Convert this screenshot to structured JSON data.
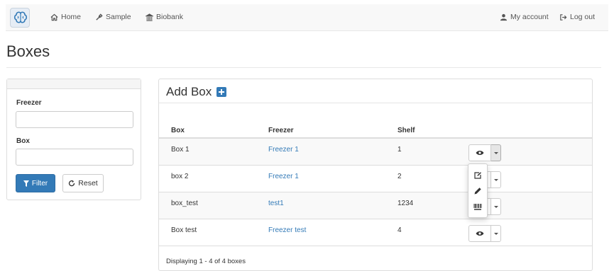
{
  "nav": {
    "brand_icon": "brain-logo-icon",
    "items": [
      {
        "label": "Home",
        "icon": "home-icon"
      },
      {
        "label": "Sample",
        "icon": "eyedropper-icon"
      },
      {
        "label": "Biobank",
        "icon": "building-icon"
      }
    ],
    "right_items": [
      {
        "label": "My account",
        "icon": "user-icon"
      },
      {
        "label": "Log out",
        "icon": "logout-icon"
      }
    ]
  },
  "page": {
    "title": "Boxes"
  },
  "filter": {
    "freezer_label": "Freezer",
    "freezer_value": "",
    "box_label": "Box",
    "box_value": "",
    "filter_button": "Filter",
    "reset_button": "Reset"
  },
  "boxes_panel": {
    "title": "Add Box",
    "columns": [
      "Box",
      "Freezer",
      "Shelf"
    ],
    "rows": [
      {
        "box": "Box 1",
        "freezer": "Freezer 1",
        "shelf": "1"
      },
      {
        "box": "box 2",
        "freezer": "Freezer 1",
        "shelf": "2"
      },
      {
        "box": "box_test",
        "freezer": "test1",
        "shelf": "1234"
      },
      {
        "box": "Box test",
        "freezer": "Freezer test",
        "shelf": "4"
      }
    ],
    "footer": "Displaying 1 - 4 of 4 boxes"
  },
  "dropdown_menu": {
    "open_for_row": 0,
    "items": [
      "edit-icon",
      "pencil-icon",
      "barcode-icon"
    ]
  },
  "colors": {
    "primary": "#337ab7",
    "link": "#337ab7",
    "navbar_bg": "#f8f8f8"
  }
}
